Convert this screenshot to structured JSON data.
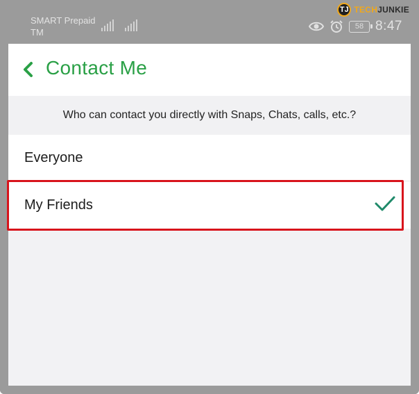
{
  "status_bar": {
    "carrier_line1": "SMART Prepaid",
    "carrier_line2": "TM",
    "battery_level": "58",
    "time": "8:47",
    "icons": [
      "signal-icon",
      "signal-icon",
      "eye-icon",
      "alarm-icon",
      "battery-icon"
    ]
  },
  "watermark": {
    "badge": "TJ",
    "brand_part1": "TECH",
    "brand_part2": "JUNKIE"
  },
  "header": {
    "title": "Contact Me",
    "back_icon": "chevron-left-icon"
  },
  "description": "Who can contact you directly with Snaps, Chats, calls, etc.?",
  "options": [
    {
      "label": "Everyone",
      "selected": false
    },
    {
      "label": "My Friends",
      "selected": true
    }
  ],
  "colors": {
    "accent_green": "#2aa046",
    "highlight_red": "#d8141c",
    "check_teal": "#1f8a6a",
    "status_bar_gray": "#9b9b9b"
  }
}
